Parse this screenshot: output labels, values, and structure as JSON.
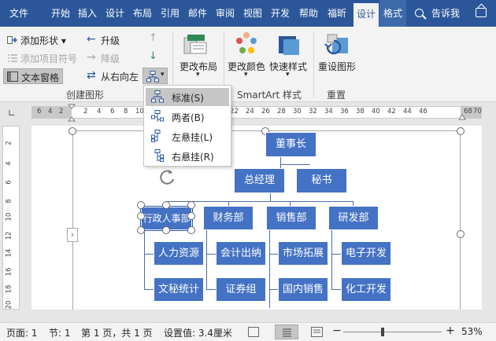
{
  "tabs": [
    "文件",
    "开始",
    "插入",
    "设计",
    "布局",
    "引用",
    "邮件",
    "审阅",
    "视图",
    "开发",
    "帮助",
    "福昕",
    "设计",
    "格式"
  ],
  "search": {
    "label": "告诉我"
  },
  "ribbon": {
    "create_graphic": {
      "add_shape": "添加形状",
      "add_bullet": "添加项目符号",
      "text_pane": "文本窗格",
      "promote": "升级",
      "demote": "降级",
      "right_to_left": "从右向左",
      "label": "创建图形"
    },
    "change_layout": "更改布局",
    "change_colors": "更改颜色",
    "quick_styles": "快速样式",
    "smartart_styles_label": "SmartArt 样式",
    "reset_graphic": "重设图形",
    "reset_label": "重置"
  },
  "menu": [
    {
      "label": "标准(S)"
    },
    {
      "label": "两者(B)"
    },
    {
      "label": "左悬挂(L)"
    },
    {
      "label": "右悬挂(R)"
    }
  ],
  "ruler": {
    "left_nums": [
      "6",
      "4",
      "2"
    ],
    "nums": [
      "2",
      "4",
      "6",
      "8",
      "10",
      "12",
      "14",
      "16",
      "18",
      "20",
      "22",
      "24",
      "26",
      "28",
      "30",
      "32",
      "34",
      "36",
      "38",
      "40",
      "42",
      "44",
      "46"
    ],
    "right_num": "68",
    "right_extra": "70",
    "vnums": [
      "2",
      "4",
      "6",
      "8",
      "10",
      "12",
      "14",
      "16",
      "18",
      "20"
    ]
  },
  "org": {
    "chairman": "董事长",
    "gm": "总经理",
    "secretary": "秘书",
    "depts": [
      "行政人事部",
      "财务部",
      "销售部",
      "研发部"
    ],
    "subs": [
      [
        "人力资源",
        "文秘统计"
      ],
      [
        "会计出纳",
        "证券组"
      ],
      [
        "市场拓展",
        "国内销售"
      ],
      [
        "电子开发",
        "化工开发"
      ]
    ]
  },
  "status": {
    "page": "页面: 1",
    "section": "节: 1",
    "page_of": "第 1 页，共 1 页",
    "setting": "设置值: 3.4厘米",
    "zoom": "53%"
  },
  "colors": {
    "accent": "#2b579a",
    "node": "#4472c4"
  }
}
